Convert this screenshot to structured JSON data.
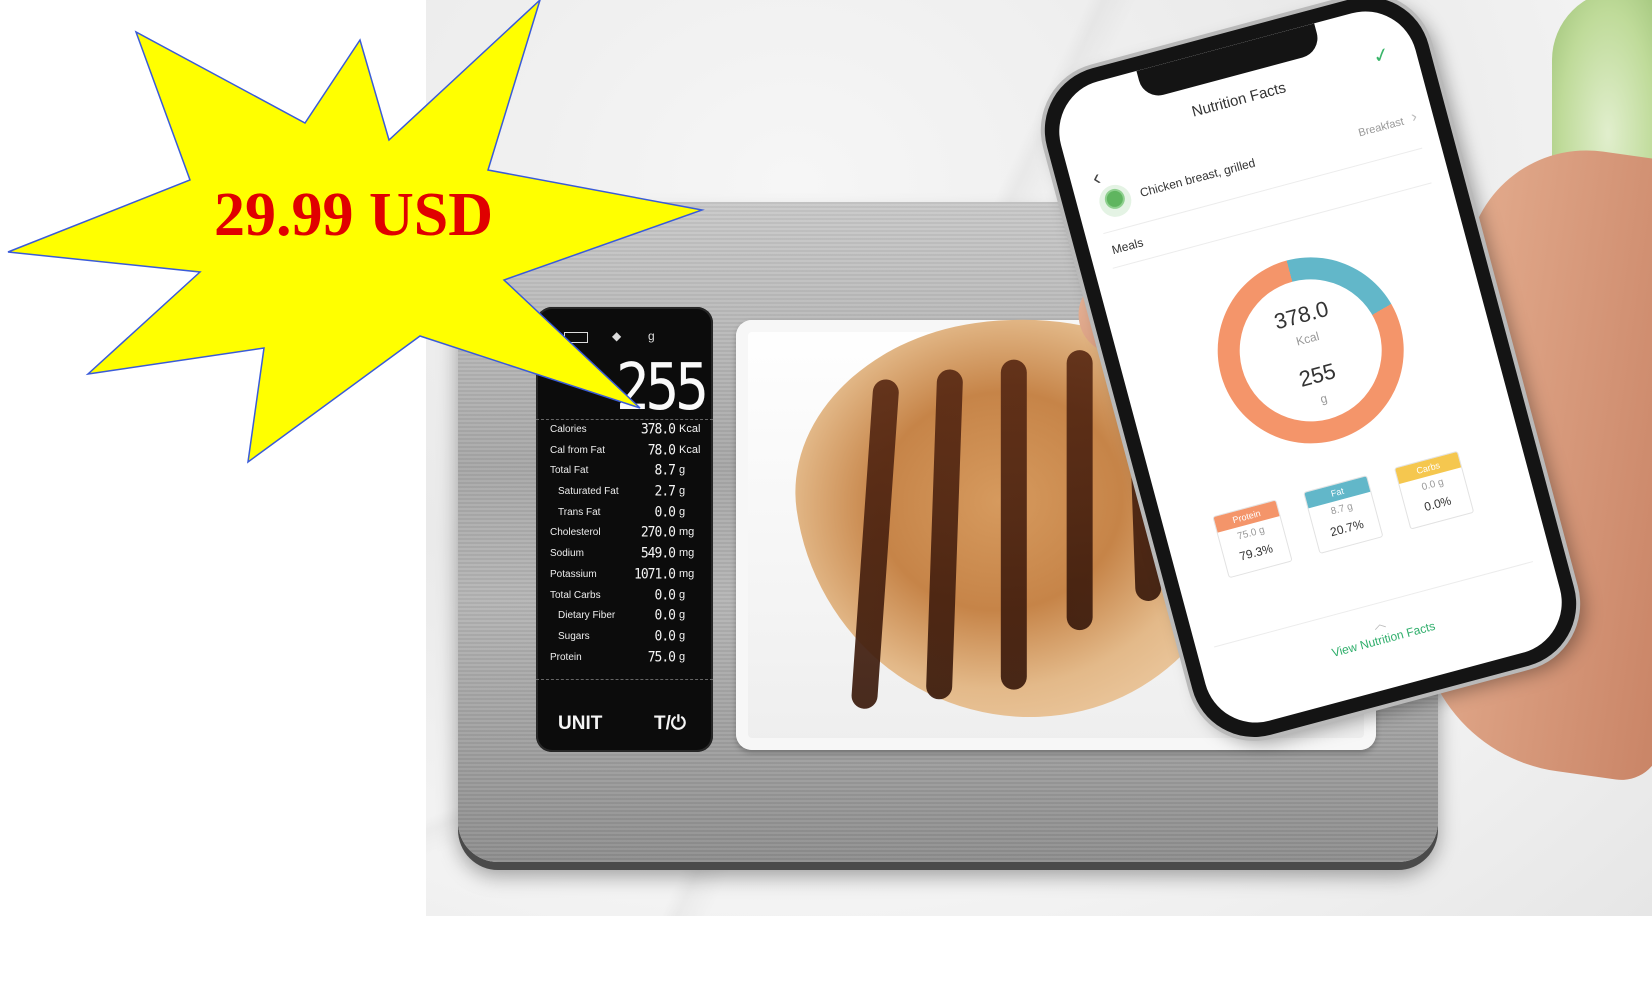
{
  "price_badge": {
    "text": "29.99 USD",
    "fill": "#ffff00",
    "text_color": "#e00000"
  },
  "scale_display": {
    "status_icons": [
      "bluetooth-icon",
      "battery-icon",
      "cube-icon"
    ],
    "unit_top": "g",
    "weight": "255",
    "rows": [
      {
        "label": "Calories",
        "value": "378.0",
        "unit": "Kcal",
        "indent": false
      },
      {
        "label": "Cal from Fat",
        "value": "78.0",
        "unit": "Kcal",
        "indent": false
      },
      {
        "label": "Total Fat",
        "value": "8.7",
        "unit": "g",
        "indent": false
      },
      {
        "label": "Saturated Fat",
        "value": "2.7",
        "unit": "g",
        "indent": true
      },
      {
        "label": "Trans Fat",
        "value": "0.0",
        "unit": "g",
        "indent": true
      },
      {
        "label": "Cholesterol",
        "value": "270.0",
        "unit": "mg",
        "indent": false
      },
      {
        "label": "Sodium",
        "value": "549.0",
        "unit": "mg",
        "indent": false
      },
      {
        "label": "Potassium",
        "value": "1071.0",
        "unit": "mg",
        "indent": false
      },
      {
        "label": "Total Carbs",
        "value": "0.0",
        "unit": "g",
        "indent": false
      },
      {
        "label": "Dietary Fiber",
        "value": "0.0",
        "unit": "g",
        "indent": true
      },
      {
        "label": "Sugars",
        "value": "0.0",
        "unit": "g",
        "indent": true
      },
      {
        "label": "Protein",
        "value": "75.0",
        "unit": "g",
        "indent": false
      }
    ],
    "unit_button": "UNIT",
    "tare_button": "T/⏻"
  },
  "phone_app": {
    "title": "Nutrition Facts",
    "back_icon": "chevron-left-icon",
    "confirm_icon": "check-icon",
    "food_name": "Chicken breast, grilled",
    "meal_type": "Breakfast",
    "meals_label": "Meals",
    "donut": {
      "kcal_value": "378.0",
      "kcal_unit": "Kcal",
      "weight_value": "255",
      "weight_unit": "g",
      "protein_color": "#f4956a",
      "fat_color": "#62b7c9"
    },
    "macros": [
      {
        "name": "Protein",
        "grams": "75.0 g",
        "percent": "79.3%",
        "color": "#f4956a"
      },
      {
        "name": "Fat",
        "grams": "8.7 g",
        "percent": "20.7%",
        "color": "#62b7c9"
      },
      {
        "name": "Carbs",
        "grams": "0.0 g",
        "percent": "0.0%",
        "color": "#f5c74f"
      }
    ],
    "view_link": "View Nutrition Facts"
  }
}
